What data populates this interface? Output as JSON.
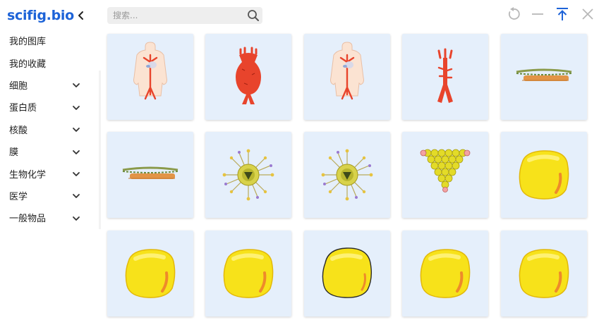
{
  "sidebar": {
    "brand": "scifig.bio",
    "items": [
      {
        "label": "我的图库",
        "expandable": false
      },
      {
        "label": "我的收藏",
        "expandable": false
      },
      {
        "label": "细胞",
        "expandable": true
      },
      {
        "label": "蛋白质",
        "expandable": true
      },
      {
        "label": "核酸",
        "expandable": true
      },
      {
        "label": "膜",
        "expandable": true
      },
      {
        "label": "生物化学",
        "expandable": true
      },
      {
        "label": "医学",
        "expandable": true
      },
      {
        "label": "一般物品",
        "expandable": true
      }
    ]
  },
  "search": {
    "placeholder": "搜索...",
    "value": ""
  },
  "colors": {
    "brand": "#1d63d8",
    "card_bg": "#e5effb",
    "pin_active": "#1d63d8",
    "toolbar_icon": "#b8b8b8"
  },
  "grid": {
    "items": [
      {
        "icon": "human-torso-cardiovascular-icon"
      },
      {
        "icon": "aorta-aneurysm-icon"
      },
      {
        "icon": "human-torso-cardiovascular-icon"
      },
      {
        "icon": "aorta-artery-icon"
      },
      {
        "icon": "collagen-fiber-icon"
      },
      {
        "icon": "collagen-fiber-icon"
      },
      {
        "icon": "lipid-nanoparticle-icon"
      },
      {
        "icon": "lipid-nanoparticle-icon"
      },
      {
        "icon": "nanoparticle-pyramid-icon"
      },
      {
        "icon": "yellow-blob-icon"
      },
      {
        "icon": "yellow-blob-icon"
      },
      {
        "icon": "yellow-blob-icon"
      },
      {
        "icon": "yellow-blob-outlined-icon"
      },
      {
        "icon": "yellow-blob-icon"
      },
      {
        "icon": "yellow-blob-icon"
      }
    ]
  }
}
